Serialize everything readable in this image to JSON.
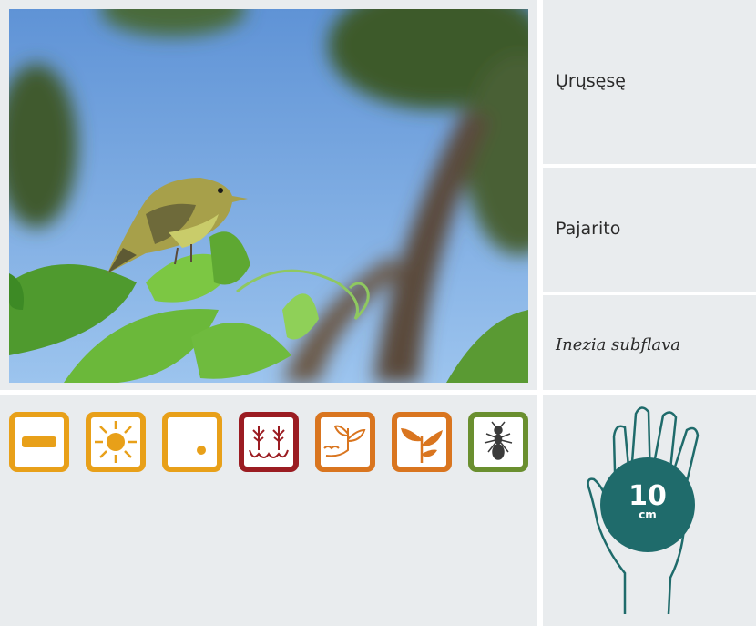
{
  "names": {
    "local": "Ųrųsęsę",
    "spanish": "Pajarito",
    "scientific": "Inezia subflava"
  },
  "size": {
    "value": "10",
    "unit": "cm"
  },
  "icons": [
    {
      "name": "horizontal-bar-icon",
      "color": "#e8a019"
    },
    {
      "name": "sun-icon",
      "color": "#e8a019"
    },
    {
      "name": "dot-icon",
      "color": "#e8a019"
    },
    {
      "name": "flooded-forest-icon",
      "color": "#9b1c22"
    },
    {
      "name": "riverbank-plant-icon",
      "color": "#d9751f"
    },
    {
      "name": "leafy-plant-icon",
      "color": "#d9751f"
    },
    {
      "name": "ant-icon",
      "color": "#6a8f2f"
    }
  ],
  "colors": {
    "panel": "#e9ecee",
    "teal": "#1f6b6b"
  }
}
